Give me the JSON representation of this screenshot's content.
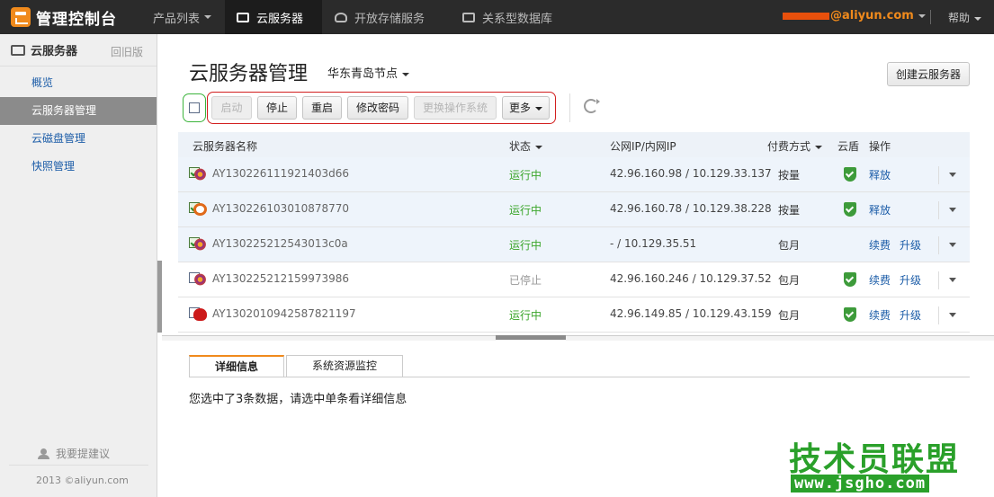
{
  "topbar": {
    "logo_text": "管理控制台",
    "nav": [
      {
        "label": "产品列表"
      },
      {
        "label": "云服务器"
      },
      {
        "label": "开放存储服务"
      },
      {
        "label": "关系型数据库"
      }
    ],
    "user_suffix": "@aliyun.com",
    "help": "帮助"
  },
  "sidebar": {
    "title": "云服务器",
    "old_version": "回旧版",
    "items": [
      {
        "label": "概览"
      },
      {
        "label": "云服务器管理"
      },
      {
        "label": "云磁盘管理"
      },
      {
        "label": "快照管理"
      }
    ],
    "feedback": "我要提建议",
    "copyright": "2013 ©aliyun.com"
  },
  "main": {
    "title": "云服务器管理",
    "region": "华东青岛节点",
    "create_button": "创建云服务器",
    "toolbar": {
      "start": "启动",
      "stop": "停止",
      "restart": "重启",
      "change_password": "修改密码",
      "change_os": "更换操作系统",
      "more": "更多"
    },
    "columns": {
      "name": "云服务器名称",
      "status": "状态",
      "ip": "公网IP/内网IP",
      "billing": "付费方式",
      "shield": "云盾",
      "ops": "操作"
    },
    "rows": [
      {
        "name": "AY130226111921403d66",
        "status": "运行中",
        "ip": "42.96.160.98 / 10.129.33.137",
        "billing": "按量",
        "op1": "释放",
        "op2": ""
      },
      {
        "name": "AY130226103010878770",
        "status": "运行中",
        "ip": "42.96.160.78 / 10.129.38.228",
        "billing": "按量",
        "op1": "释放",
        "op2": ""
      },
      {
        "name": "AY130225212543013c0a",
        "status": "运行中",
        "ip": "- / 10.129.35.51",
        "billing": "包月",
        "op1": "续费",
        "op2": "升级"
      },
      {
        "name": "AY130225212159973986",
        "status": "已停止",
        "ip": "42.96.160.246 / 10.129.37.52",
        "billing": "包月",
        "op1": "续费",
        "op2": "升级"
      },
      {
        "name": "AY130201094258782119​7",
        "status": "运行中",
        "ip": "42.96.149.85 / 10.129.43.159",
        "billing": "包月",
        "op1": "续费",
        "op2": "升级"
      }
    ],
    "tabs": [
      {
        "label": "详细信息"
      },
      {
        "label": "系统资源监控"
      }
    ],
    "detail_message": "您选中了3条数据，请选中单条看详细信息"
  },
  "watermark": {
    "line1": "技术员联盟",
    "line2": "www.jsgho.com"
  },
  "colors": {
    "accent": "#f08a1c",
    "running": "#3aa52a",
    "link": "#1c5da8",
    "ring_green": "#3cb43c",
    "ring_red": "#d21e1e",
    "ring_blue": "#1e2896"
  }
}
